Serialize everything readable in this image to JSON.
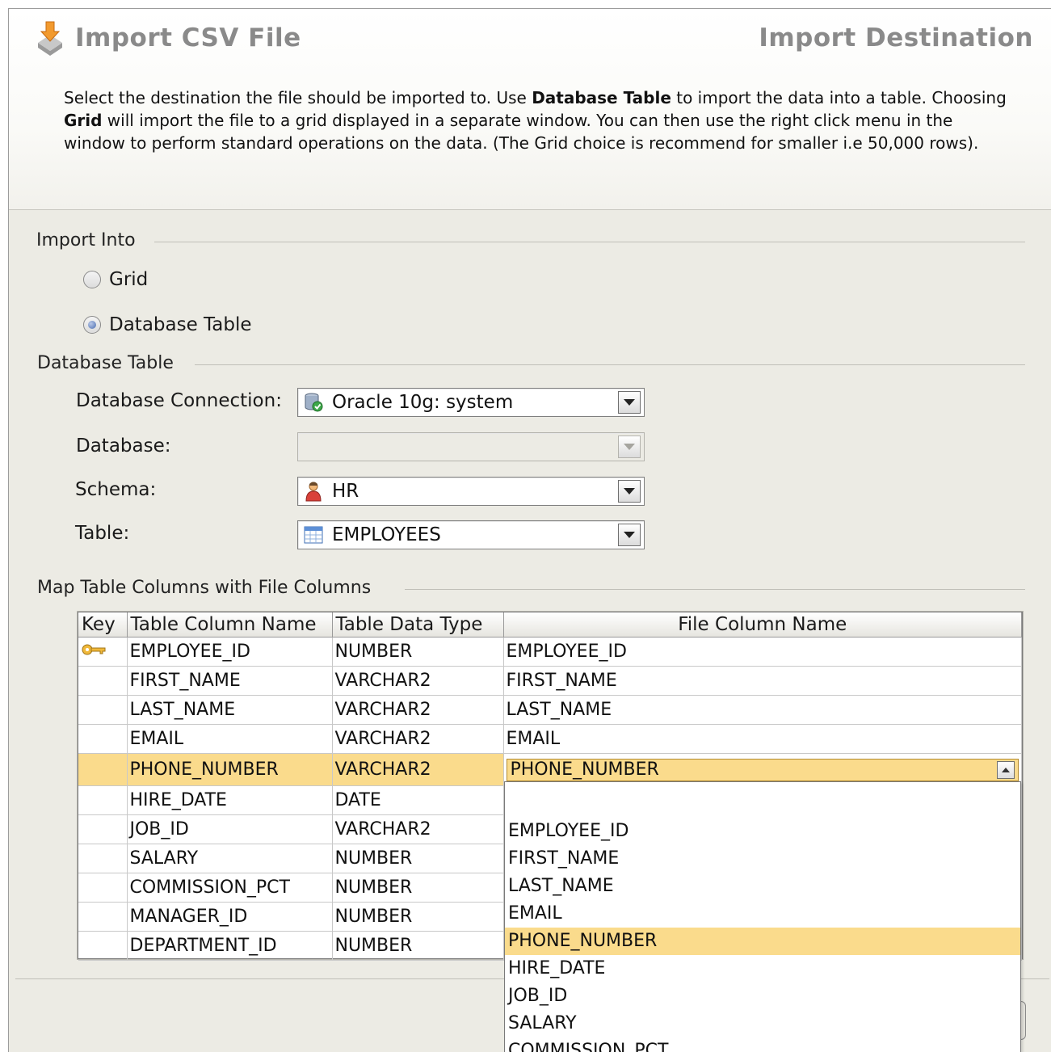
{
  "header": {
    "title": "Import CSV File",
    "step": "Import Destination",
    "desc": {
      "p1": "Select the destination the file should be imported to. Use ",
      "b1": "Database Table",
      "p2": " to import the data into a table. Choosing ",
      "b2": "Grid",
      "p3": " will import the file to a grid displayed in a separate window. You can then use the right click menu in the window to perform standard operations on the data. (The Grid choice is recommend for smaller i.e 50,000 rows)."
    }
  },
  "import_into": {
    "label": "Import Into",
    "options": [
      {
        "label": "Grid",
        "selected": false
      },
      {
        "label": "Database Table",
        "selected": true
      }
    ]
  },
  "database_table": {
    "label": "Database Table",
    "connection": {
      "label": "Database Connection:",
      "value": "Oracle 10g: system",
      "icon": "database-connection-icon"
    },
    "database": {
      "label": "Database:",
      "value": ""
    },
    "schema": {
      "label": "Schema:",
      "value": "HR",
      "icon": "user-schema-icon"
    },
    "table": {
      "label": "Table:",
      "value": "EMPLOYEES",
      "icon": "table-icon"
    }
  },
  "mapping": {
    "label": "Map Table Columns with File Columns",
    "columns": [
      "Key",
      "Table Column Name",
      "Table Data Type",
      "File Column Name"
    ],
    "rows": [
      {
        "key": true,
        "name": "EMPLOYEE_ID",
        "type": "NUMBER",
        "file": "EMPLOYEE_ID"
      },
      {
        "key": false,
        "name": "FIRST_NAME",
        "type": "VARCHAR2",
        "file": "FIRST_NAME"
      },
      {
        "key": false,
        "name": "LAST_NAME",
        "type": "VARCHAR2",
        "file": "LAST_NAME"
      },
      {
        "key": false,
        "name": "EMAIL",
        "type": "VARCHAR2",
        "file": "EMAIL"
      },
      {
        "key": false,
        "name": "PHONE_NUMBER",
        "type": "VARCHAR2",
        "file": "PHONE_NUMBER",
        "selected": true
      },
      {
        "key": false,
        "name": "HIRE_DATE",
        "type": "DATE",
        "file": ""
      },
      {
        "key": false,
        "name": "JOB_ID",
        "type": "VARCHAR2",
        "file": ""
      },
      {
        "key": false,
        "name": "SALARY",
        "type": "NUMBER",
        "file": ""
      },
      {
        "key": false,
        "name": "COMMISSION_PCT",
        "type": "NUMBER",
        "file": ""
      },
      {
        "key": false,
        "name": "MANAGER_ID",
        "type": "NUMBER",
        "file": ""
      },
      {
        "key": false,
        "name": "DEPARTMENT_ID",
        "type": "NUMBER",
        "file": ""
      }
    ],
    "dropdown_options": [
      "",
      "EMPLOYEE_ID",
      "FIRST_NAME",
      "LAST_NAME",
      "EMAIL",
      "PHONE_NUMBER",
      "HIRE_DATE",
      "JOB_ID",
      "SALARY",
      "COMMISSION_PCT"
    ],
    "dropdown_active": "PHONE_NUMBER"
  },
  "colors": {
    "selection": "#fadb8c",
    "background": "#ecebe4"
  }
}
